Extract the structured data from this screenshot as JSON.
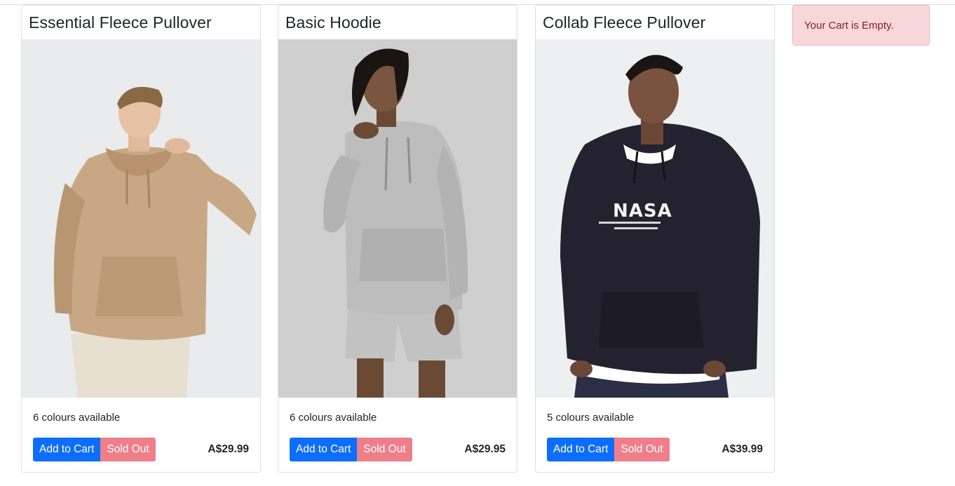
{
  "products": [
    {
      "title": "Essential Fleece Pullover",
      "colours": "6 colours available",
      "add_label": "Add to Cart",
      "sold_label": "Sold Out",
      "price": "A$29.99",
      "garment_color": "#c8a884",
      "bg_color": "#e9ebec"
    },
    {
      "title": "Basic Hoodie",
      "colours": "6 colours available",
      "add_label": "Add to Cart",
      "sold_label": "Sold Out",
      "price": "A$29.95",
      "garment_color": "#bdbdbd",
      "bg_color": "#cfcfcf"
    },
    {
      "title": "Collab Fleece Pullover",
      "colours": "5 colours available",
      "add_label": "Add to Cart",
      "sold_label": "Sold Out",
      "price": "A$39.99",
      "garment_color": "#23222e",
      "bg_color": "#eeeff1",
      "graphic_text": "NASA"
    }
  ],
  "cart": {
    "message": "Your Cart is Empty."
  },
  "colors": {
    "primary": "#0d6efd",
    "sold_out": "#ee7f8a",
    "alert_bg": "#f8d7da",
    "alert_text": "#842029"
  }
}
